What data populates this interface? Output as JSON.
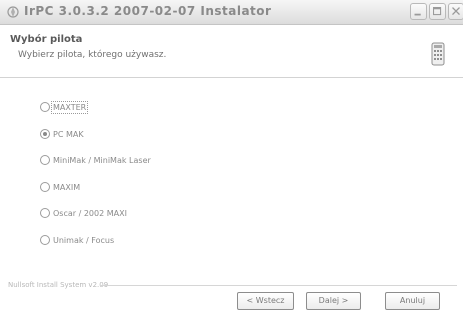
{
  "window": {
    "title": "IrPC 3.0.3.2 2007-02-07 Instalator",
    "icons": {
      "app": "installer-icon",
      "minimize": "minimize-icon",
      "maximize": "maximize-icon",
      "close": "close-icon"
    }
  },
  "header": {
    "title": "Wybór pilota",
    "subtitle": "Wybierz pilota, którego używasz.",
    "icon": "remote-control-icon"
  },
  "options": {
    "items": [
      {
        "label": "MAXTER"
      },
      {
        "label": "PC MAK"
      },
      {
        "label": "MiniMak / MiniMak Laser"
      },
      {
        "label": "MAXIM"
      },
      {
        "label": "Oscar / 2002 MAXI"
      },
      {
        "label": "Unimak / Focus"
      }
    ],
    "selected": "PC MAK"
  },
  "footer": {
    "brand": "Nullsoft Install System v2.09",
    "back_label": "< Wstecz",
    "next_label": "Dalej >",
    "cancel_label": "Anuluj"
  }
}
